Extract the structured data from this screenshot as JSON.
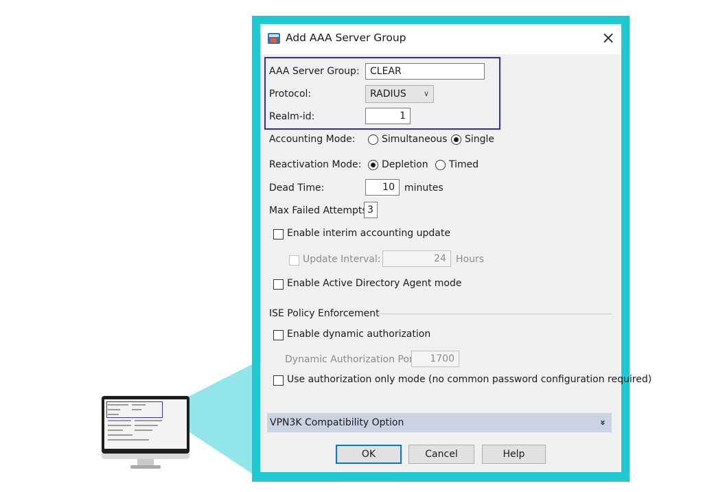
{
  "dialog": {
    "title": "Add AAA Server Group",
    "close_symbol": "×",
    "server_group": {
      "label": "AAA Server Group:",
      "value": "CLEAR"
    },
    "protocol": {
      "label": "Protocol:",
      "value": "RADIUS"
    },
    "realm_id": {
      "label": "Realm-id:",
      "value": "1"
    },
    "accounting_mode": {
      "label": "Accounting Mode:",
      "options": [
        "Simultaneous",
        "Single"
      ],
      "selected": "Single"
    },
    "reactivation_mode": {
      "label": "Reactivation Mode:",
      "options": [
        "Depletion",
        "Timed"
      ],
      "selected": "Depletion"
    },
    "dead_time": {
      "label": "Dead Time:",
      "value": "10",
      "unit": "minutes"
    },
    "max_failed_attempts": {
      "label": "Max Failed Attempts:",
      "value": "3"
    },
    "interim_accounting": {
      "label": "Enable interim accounting update",
      "checked": false
    },
    "update_interval": {
      "label": "Update Interval:",
      "value": "24",
      "unit": "Hours",
      "checked": false,
      "enabled": false
    },
    "ad_agent_mode": {
      "label": "Enable Active Directory Agent mode",
      "checked": false
    },
    "ise_section": {
      "title": "ISE Policy Enforcement",
      "dynamic_authorization": {
        "label": "Enable dynamic authorization",
        "checked": false
      },
      "dynamic_port": {
        "label": "Dynamic Authorization Port:",
        "value": "1700",
        "enabled": false
      },
      "authorization_only": {
        "label": "Use authorization only mode (no common password configuration required)",
        "checked": false
      }
    },
    "vpn3k": {
      "label": "VPN3K Compatibility Option",
      "expand_symbol": "»"
    },
    "buttons": {
      "ok": "OK",
      "cancel": "Cancel",
      "help": "Help"
    }
  },
  "colors": {
    "frame_accent": "#1fc9cf",
    "highlight_box": "#30309c",
    "section_bar": "#cbd3e2",
    "dialog_bg": "#f0f0f0"
  },
  "icons": {
    "app": "aaa-server-app-icon",
    "close": "close-icon",
    "expand": "double-chevron-down-icon"
  }
}
